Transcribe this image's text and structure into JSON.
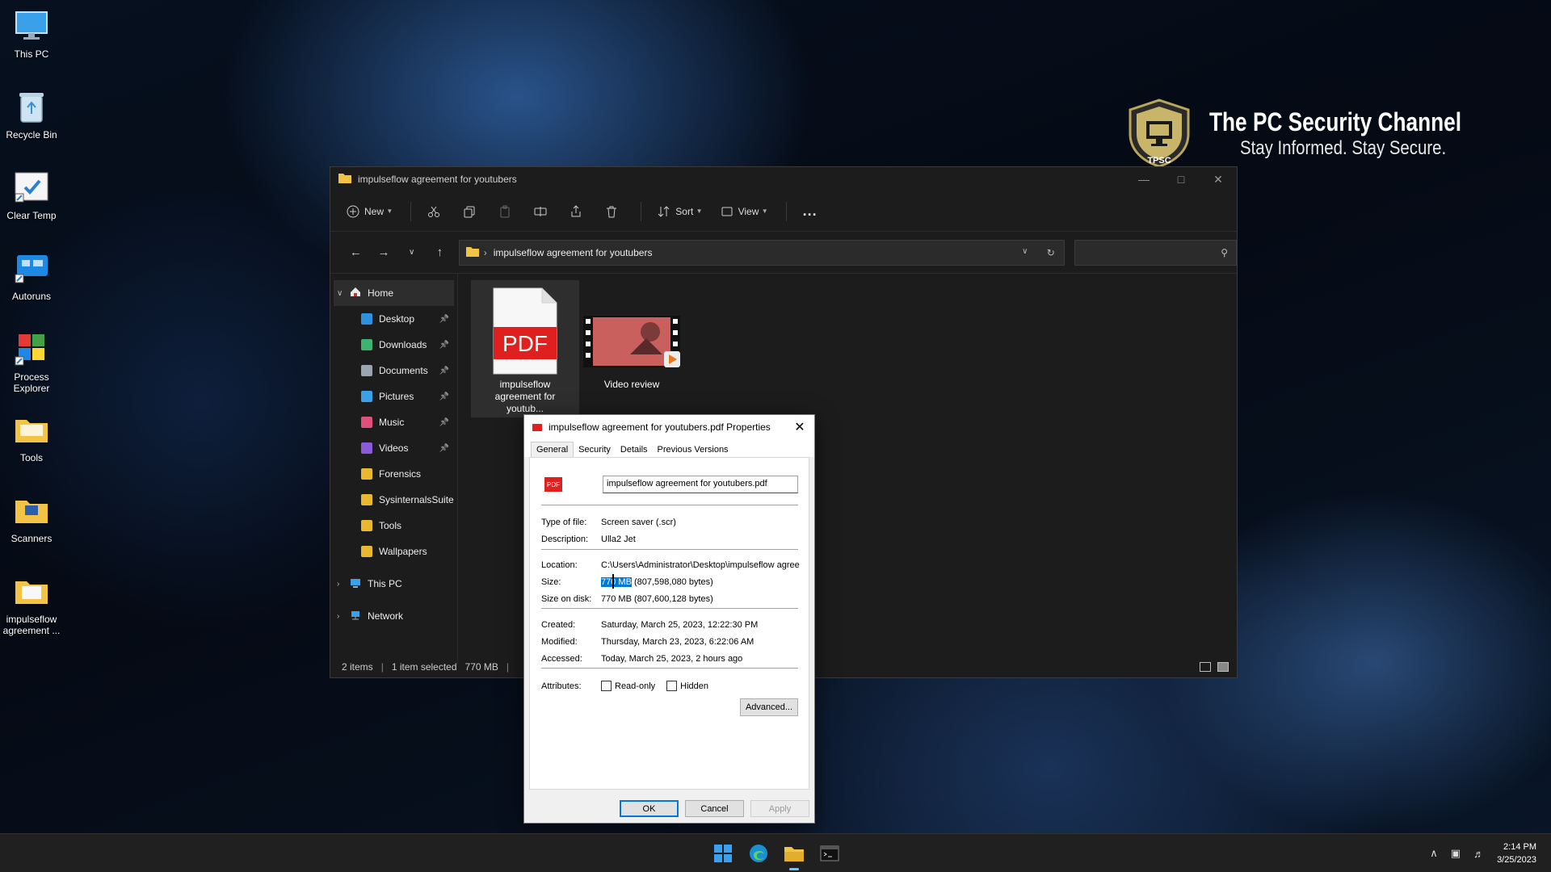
{
  "desktop": {
    "icons": [
      {
        "label": "This PC"
      },
      {
        "label": "Recycle Bin"
      },
      {
        "label": "Clear Temp"
      },
      {
        "label": "Autoruns"
      },
      {
        "label": "Process Explorer"
      },
      {
        "label": "Tools"
      },
      {
        "label": "Scanners"
      },
      {
        "label": "impulseflow agreement ..."
      }
    ]
  },
  "branding": {
    "badge": "TPSC",
    "title": "The PC Security Channel",
    "tagline": "Stay Informed. Stay Secure."
  },
  "explorer": {
    "title": "impulseflow agreement for youtubers",
    "toolbar": {
      "new_label": "New",
      "sort_label": "Sort",
      "view_label": "View",
      "more_label": "..."
    },
    "address_path": "impulseflow agreement for youtubers",
    "nav": {
      "home": "Home",
      "items": [
        {
          "label": "Desktop",
          "color": "#2f8fe0"
        },
        {
          "label": "Downloads",
          "color": "#3cb371"
        },
        {
          "label": "Documents",
          "color": "#9aa5b1"
        },
        {
          "label": "Pictures",
          "color": "#3aa0e8"
        },
        {
          "label": "Music",
          "color": "#e0507a"
        },
        {
          "label": "Videos",
          "color": "#8a5ad8"
        },
        {
          "label": "Forensics",
          "color": "#e8b830"
        },
        {
          "label": "SysinternalsSuite",
          "color": "#e8b830"
        },
        {
          "label": "Tools",
          "color": "#e8b830"
        },
        {
          "label": "Wallpapers",
          "color": "#e8b830"
        }
      ],
      "this_pc": "This PC",
      "network": "Network"
    },
    "files": [
      {
        "name": "impulseflow agreement for youtub...",
        "badge": "PDF"
      },
      {
        "name": "Video review"
      }
    ],
    "status": {
      "count": "2 items",
      "selected": "1 item selected",
      "size": "770 MB"
    }
  },
  "properties": {
    "title": "impulseflow agreement for youtubers.pdf Properties",
    "tabs": [
      "General",
      "Security",
      "Details",
      "Previous Versions"
    ],
    "icon_badge": "PDF",
    "filename": "impulseflow agreement for youtubers.pdf",
    "type_label": "Type of file:",
    "type_value": "Screen saver (.scr)",
    "desc_label": "Description:",
    "desc_value": "Ulla2 Jet",
    "location_label": "Location:",
    "location_value": "C:\\Users\\Administrator\\Desktop\\impulseflow agreem",
    "size_label": "Size:",
    "size_highlight": "770 MB",
    "size_rest": " (807,598,080 bytes)",
    "disk_label": "Size on disk:",
    "disk_value": "770 MB (807,600,128 bytes)",
    "created_label": "Created:",
    "created_value": "Saturday, March 25, 2023, 12:22:30 PM",
    "modified_label": "Modified:",
    "modified_value": "Thursday, March 23, 2023, 6:22:06 AM",
    "accessed_label": "Accessed:",
    "accessed_value": "Today, March 25, 2023, 2 hours ago",
    "attributes_label": "Attributes:",
    "readonly_label": "Read-only",
    "hidden_label": "Hidden",
    "advanced_label": "Advanced...",
    "ok_label": "OK",
    "cancel_label": "Cancel",
    "apply_label": "Apply"
  },
  "taskbar": {
    "time": "2:14 PM",
    "date": "3/25/2023"
  }
}
